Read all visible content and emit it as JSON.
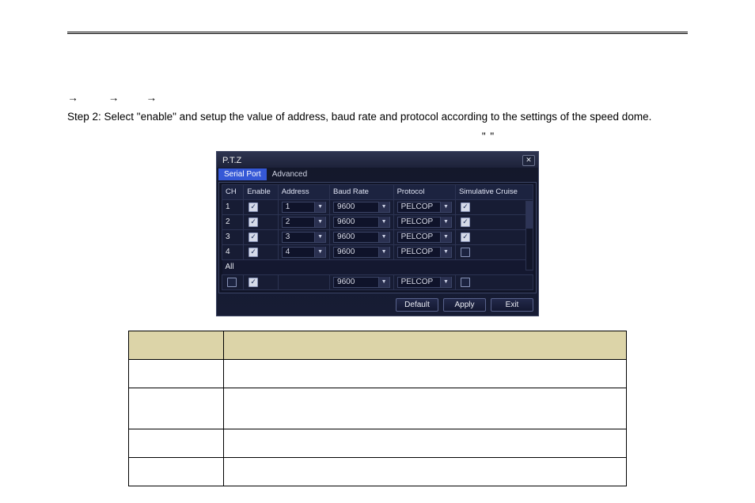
{
  "step1": {
    "a1": "→",
    "a2": "→",
    "a3": "→"
  },
  "step2": "Step 2: Select \"enable\" and setup the value of address, baud rate and protocol according to the settings of the speed dome.",
  "step3_quotes": "\" \"",
  "dialog": {
    "title": "P.T.Z",
    "tabs": {
      "serial": "Serial Port",
      "advanced": "Advanced"
    },
    "headers": {
      "ch": "CH",
      "enable": "Enable",
      "address": "Address",
      "baud": "Baud Rate",
      "protocol": "Protocol",
      "simcruise": "Simulative Cruise"
    },
    "rows": [
      {
        "ch": "1",
        "enable": true,
        "address": "1",
        "baud": "9600",
        "protocol": "PELCOP",
        "sim": true
      },
      {
        "ch": "2",
        "enable": true,
        "address": "2",
        "baud": "9600",
        "protocol": "PELCOP",
        "sim": true
      },
      {
        "ch": "3",
        "enable": true,
        "address": "3",
        "baud": "9600",
        "protocol": "PELCOP",
        "sim": true
      },
      {
        "ch": "4",
        "enable": true,
        "address": "4",
        "baud": "9600",
        "protocol": "PELCOP",
        "sim": false
      }
    ],
    "all_label": "All",
    "all_row": {
      "enable": true,
      "baud": "9600",
      "protocol": "PELCOP",
      "sim": false
    },
    "buttons": {
      "default": "Default",
      "apply": "Apply",
      "exit": "Exit"
    }
  }
}
